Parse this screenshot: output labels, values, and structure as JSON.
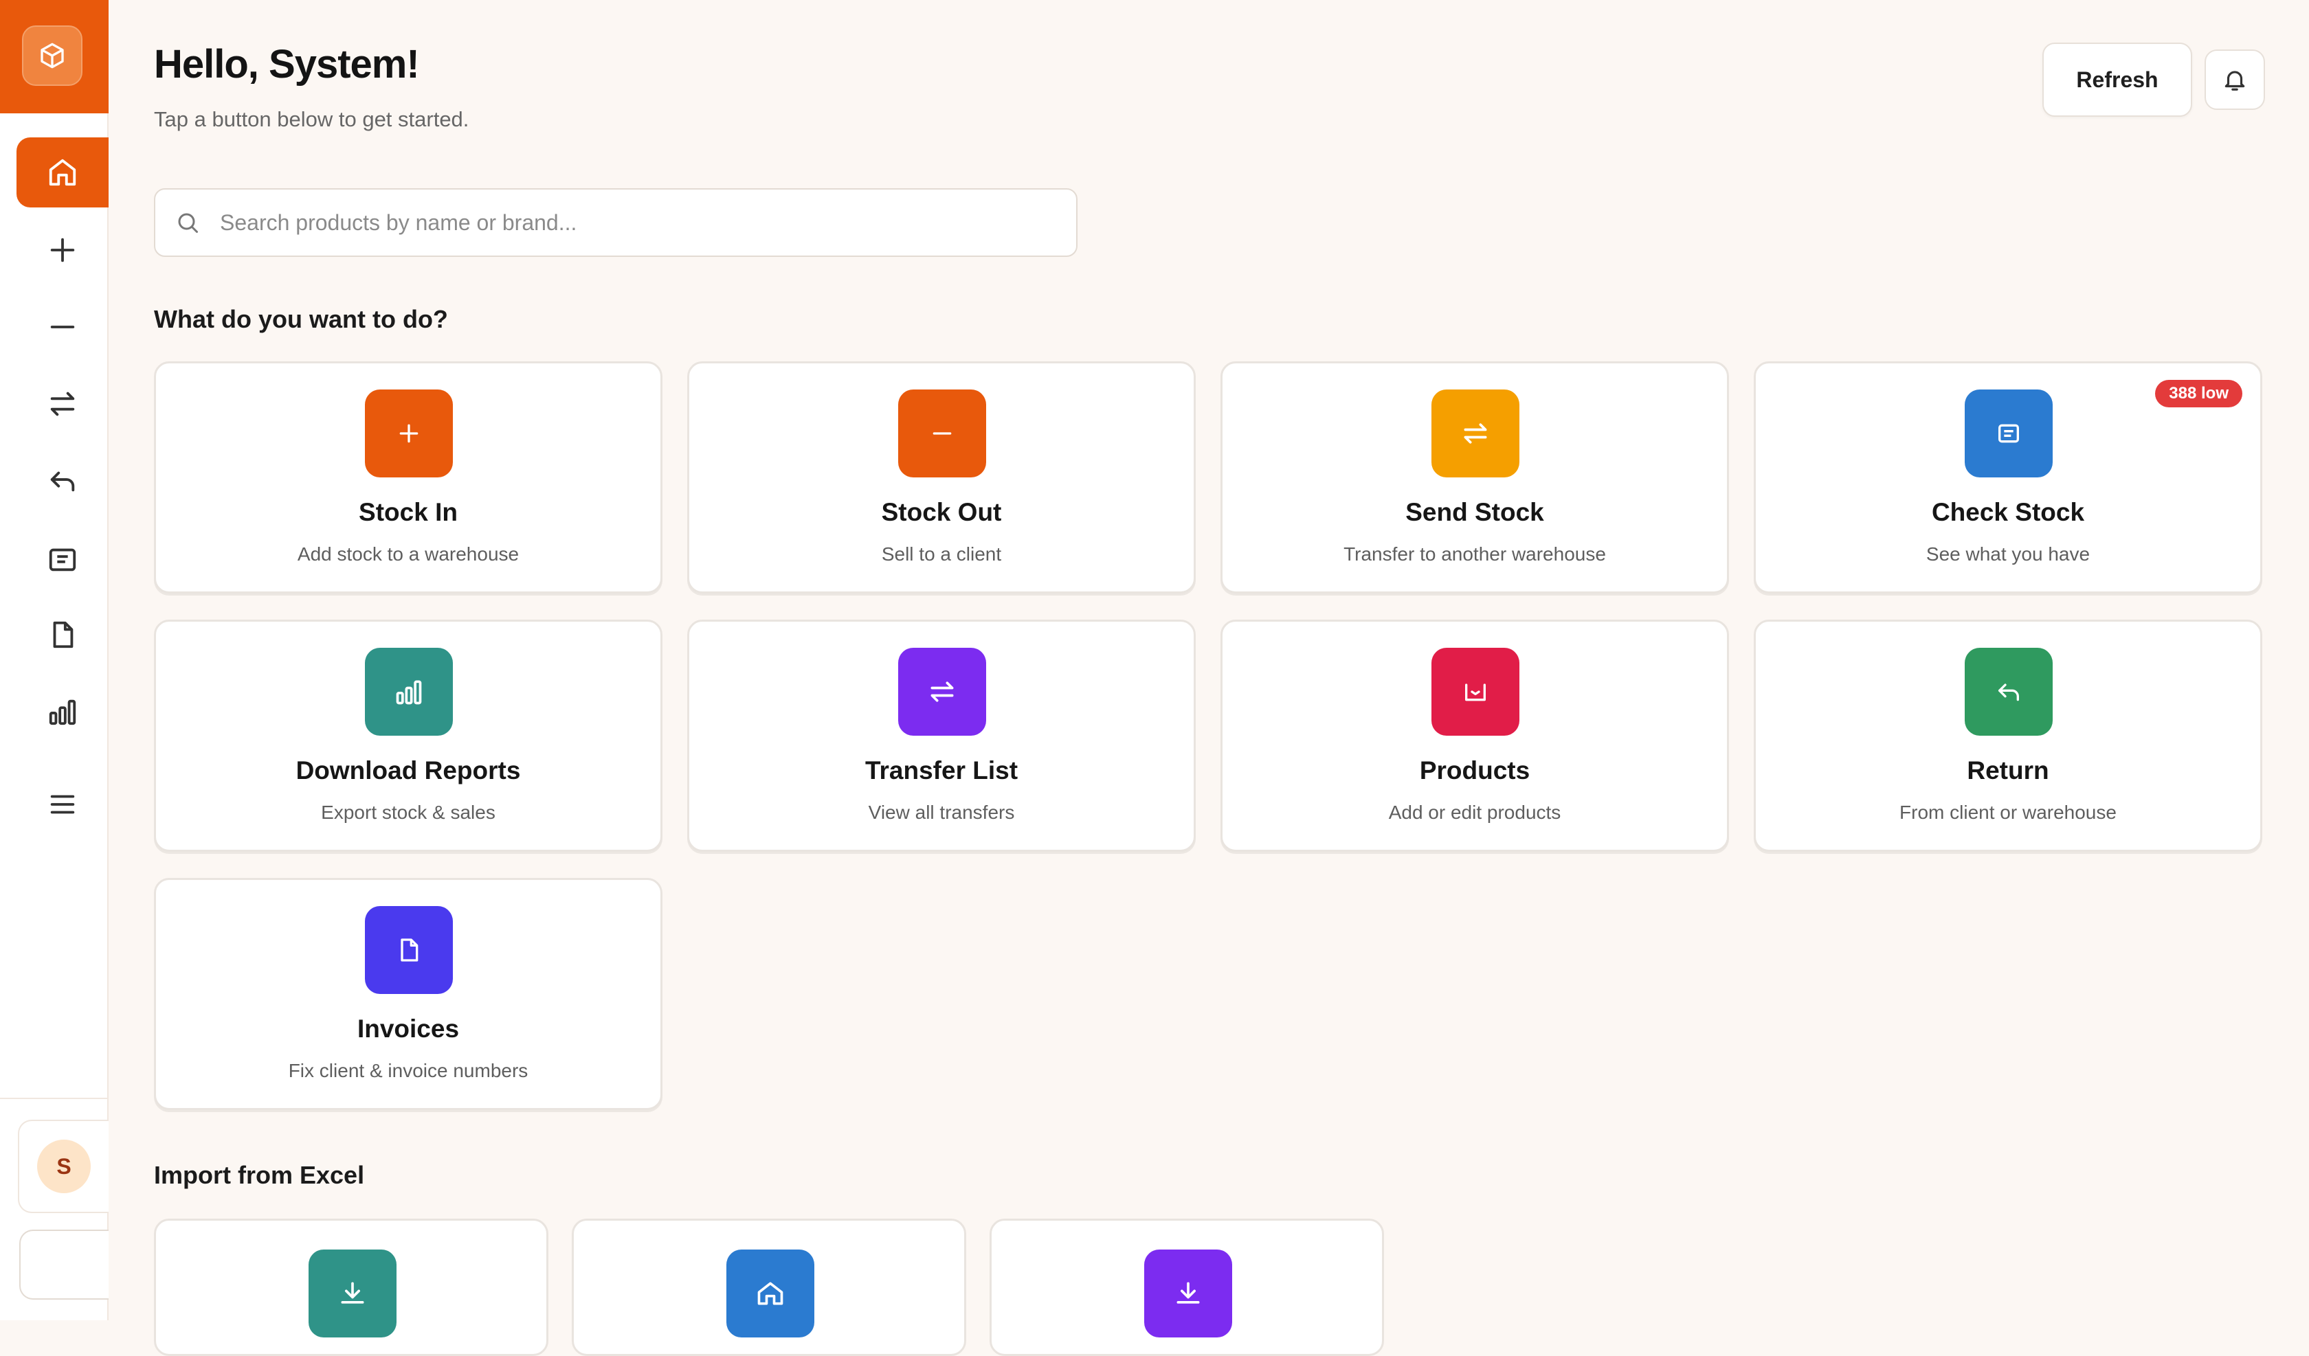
{
  "header": {
    "greeting": "Hello, System!",
    "subtitle": "Tap a button below to get started.",
    "refresh_label": "Refresh"
  },
  "search": {
    "placeholder": "Search products by name or brand..."
  },
  "sections": {
    "actions_title": "What do you want to do?",
    "import_title": "Import from Excel"
  },
  "sidebar": {
    "items": [
      {
        "icon": "home-icon",
        "active": true
      },
      {
        "icon": "plus-icon"
      },
      {
        "icon": "minus-icon"
      },
      {
        "icon": "transfer-icon"
      },
      {
        "icon": "return-icon"
      },
      {
        "icon": "inventory-icon"
      },
      {
        "icon": "document-icon"
      },
      {
        "icon": "bar-chart-icon"
      },
      {
        "icon": "menu-icon"
      }
    ],
    "avatar_initial": "S"
  },
  "cards": [
    {
      "title": "Stock In",
      "subtitle": "Add stock to a warehouse",
      "color": "#e8590c",
      "icon": "plus-icon"
    },
    {
      "title": "Stock Out",
      "subtitle": "Sell to a client",
      "color": "#e8590c",
      "icon": "minus-icon"
    },
    {
      "title": "Send Stock",
      "subtitle": "Transfer to another warehouse",
      "color": "#f59f00",
      "icon": "transfer-icon"
    },
    {
      "title": "Check Stock",
      "subtitle": "See what you have",
      "color": "#2b7bd0",
      "icon": "inventory-icon",
      "badge": "388 low"
    },
    {
      "title": "Download Reports",
      "subtitle": "Export stock & sales",
      "color": "#2f9388",
      "icon": "bar-chart-icon"
    },
    {
      "title": "Transfer List",
      "subtitle": "View all transfers",
      "color": "#7c2cf0",
      "icon": "transfer-icon"
    },
    {
      "title": "Products",
      "subtitle": "Add or edit products",
      "color": "#e11d48",
      "icon": "basket-icon"
    },
    {
      "title": "Return",
      "subtitle": "From client or warehouse",
      "color": "#2f9a5f",
      "icon": "return-icon"
    },
    {
      "title": "Invoices",
      "subtitle": "Fix client & invoice numbers",
      "color": "#4a3aee",
      "icon": "document-icon"
    }
  ],
  "import_cards": [
    {
      "color": "#2f9388",
      "icon": "download-icon"
    },
    {
      "color": "#2b7bd0",
      "icon": "home-icon"
    },
    {
      "color": "#7c2cf0",
      "icon": "download-icon"
    }
  ],
  "colors": {
    "accent": "#e8590c",
    "background": "#fcf7f3",
    "badge": "#e33b3b"
  }
}
